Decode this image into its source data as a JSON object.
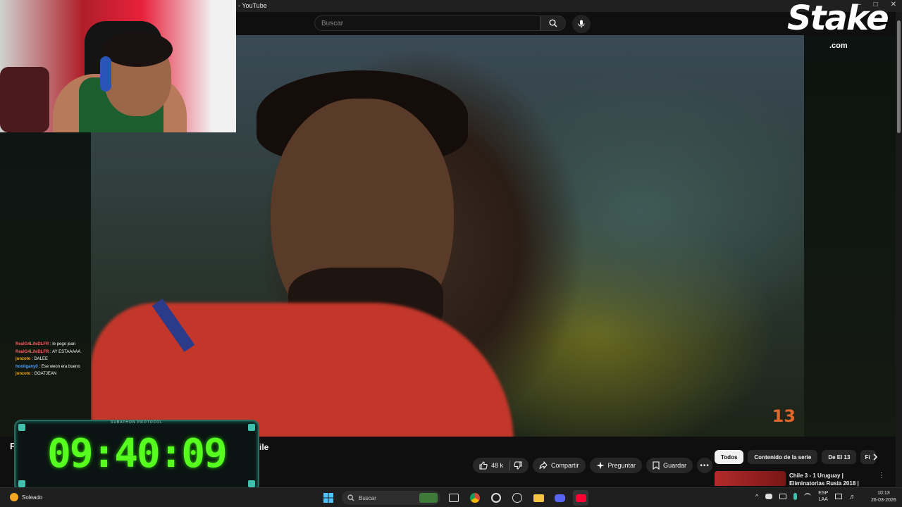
{
  "window": {
    "title": "- YouTube"
  },
  "search": {
    "placeholder": "Buscar"
  },
  "overlay": {
    "brand": "Stake",
    "brand_suffix": ".com",
    "timer_label": "SUBATHON PROTOCOL",
    "timer": "09:40:09"
  },
  "chat": [
    {
      "user": "RealG4LifeDLFR",
      "message": "le pego jean",
      "color": "#ff5a5a"
    },
    {
      "user": "RealG4LifeDLFR",
      "message": "AY ESTAAAAA",
      "color": "#ff5a5a"
    },
    {
      "user": "jonzoto",
      "message": "DALEE",
      "color": "#f5a623"
    },
    {
      "user": "hooligany0",
      "message": "Ese weon era bueno",
      "color": "#4fa3ff"
    },
    {
      "user": "jonzoto",
      "message": "GOATJEAN",
      "color": "#f5a623"
    }
  ],
  "video": {
    "title_start": "F",
    "title_end": "ile",
    "channel_logo": "13",
    "likes": "48 k",
    "share_label": "Compartir",
    "ask_label": "Preguntar",
    "save_label": "Guardar"
  },
  "chips": [
    "Todos",
    "Contenido de la serie",
    "De El 13",
    "Fi"
  ],
  "recommendation": {
    "title": "Chile 3 - 1 Uruguay | Eliminatorias Rusia 2018 |"
  },
  "taskbar": {
    "weather": "Soleado",
    "search_label": "Buscar",
    "language": "ESP",
    "language_sub": "LAA",
    "time": "10:13",
    "date": "26-03-2026"
  }
}
